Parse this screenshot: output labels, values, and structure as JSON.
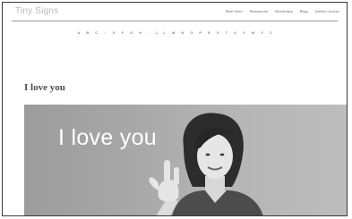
{
  "header": {
    "logo": "Tiny Signs",
    "nav": [
      "Start Here",
      "Resources",
      "Dictionary",
      "Blog",
      "Online Course"
    ]
  },
  "alphabet": [
    "A",
    "B",
    "C",
    "D",
    "E",
    "F",
    "G",
    "H",
    "I",
    "J",
    "L",
    "M",
    "N",
    "O",
    "P",
    "R",
    "S",
    "T",
    "U",
    "V",
    "W",
    "Y",
    "Z"
  ],
  "page": {
    "title": "I love you",
    "video_caption": "I love you"
  },
  "colors": {
    "nav_text": "#8f8f8f",
    "logo_text": "#b9b9b9",
    "title_text": "#4a4a4a",
    "caption_text": "#ffffff"
  }
}
